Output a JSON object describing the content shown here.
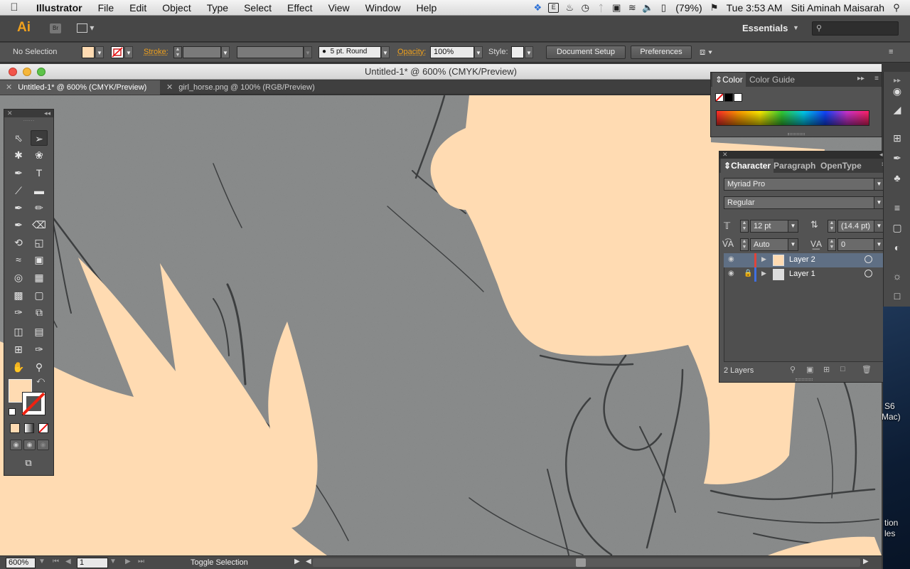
{
  "menubar": {
    "app_name": "Illustrator",
    "items": [
      "File",
      "Edit",
      "Object",
      "Type",
      "Select",
      "Effect",
      "View",
      "Window",
      "Help"
    ],
    "battery": "(79%)",
    "clock": "Tue 3:53 AM",
    "user": "Siti Aminah Maisarah"
  },
  "appbar": {
    "logo": "Ai",
    "bridge": "Br",
    "workspace": "Essentials"
  },
  "control": {
    "selection": "No Selection",
    "stroke_label": "Stroke:",
    "brush": "5 pt. Round",
    "opacity_label": "Opacity:",
    "opacity_value": "100%",
    "style_label": "Style:",
    "doc_setup": "Document Setup",
    "preferences": "Preferences"
  },
  "document": {
    "window_title": "Untitled-1* @ 600% (CMYK/Preview)",
    "tabs": [
      {
        "label": "Untitled-1* @ 600% (CMYK/Preview)"
      },
      {
        "label": "girl_horse.png @ 100% (RGB/Preview)"
      }
    ]
  },
  "status": {
    "zoom": "600%",
    "page": "1",
    "text": "Toggle Selection"
  },
  "color_panel": {
    "tabs": [
      "Color",
      "Color Guide"
    ]
  },
  "character_panel": {
    "tabs": [
      "Character",
      "Paragraph",
      "OpenType"
    ],
    "font_family": "Myriad Pro",
    "font_style": "Regular",
    "size": "12 pt",
    "leading": "(14.4 pt)",
    "kerning": "Auto",
    "tracking": "0"
  },
  "layers": {
    "rows": [
      {
        "name": "Layer 2",
        "color": "#e0443a"
      },
      {
        "name": "Layer 1",
        "color": "#3f6fe0"
      }
    ],
    "count_label": "2 Layers"
  },
  "desktop": {
    "snippets": [
      "S6",
      "Mac)",
      "tion",
      "les"
    ]
  },
  "colors": {
    "fill": "#ffdbb2",
    "accent": "#f0a11d",
    "canvas_gray": "#8a8c8c"
  },
  "icons": [
    "apple-icon",
    "dropbox-icon",
    "evernote-icon",
    "timemachine-icon",
    "bluetooth-icon",
    "display-icon",
    "wifi-icon",
    "volume-icon",
    "battery-icon",
    "flag-icon",
    "spotlight-icon"
  ]
}
